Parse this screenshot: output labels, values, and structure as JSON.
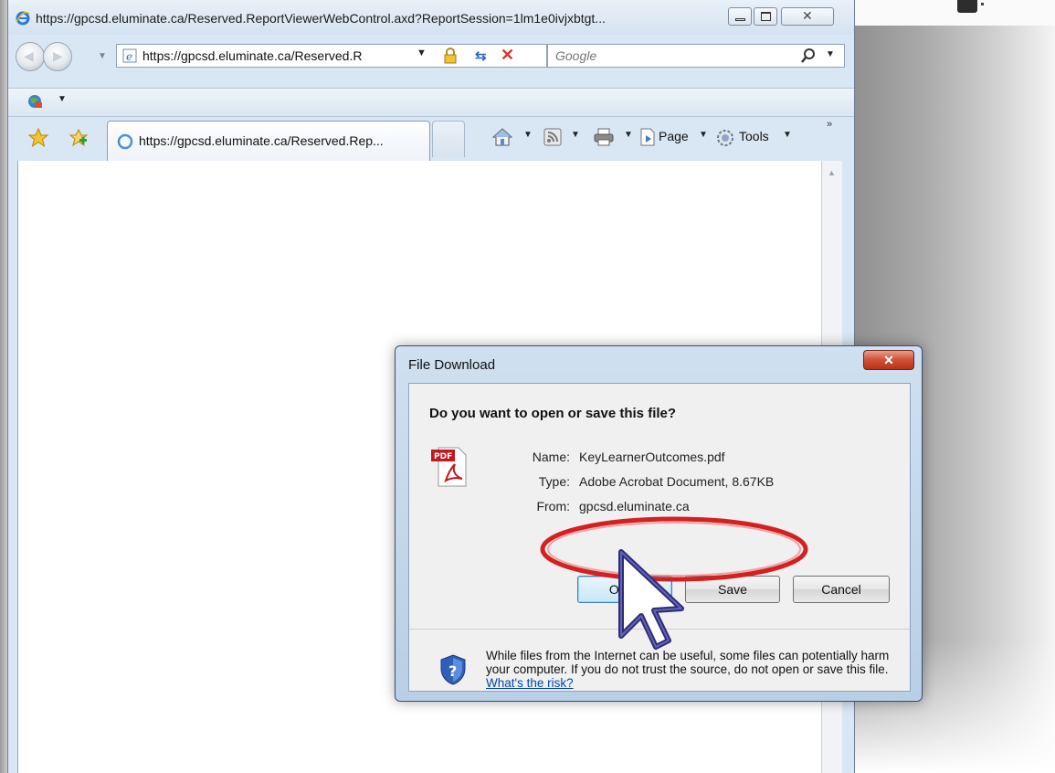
{
  "window": {
    "title": "https://gpcsd.eluminate.ca/Reserved.ReportViewerWebControl.axd?ReportSession=1lm1e0ivjxbtgt..."
  },
  "nav": {
    "address": "https://gpcsd.eluminate.ca/Reserved.R",
    "search_placeholder": "Google"
  },
  "tabs": {
    "active_label": "https://gpcsd.eluminate.ca/Reserved.Rep..."
  },
  "commands": {
    "page_label": "Page",
    "tools_label": "Tools"
  },
  "dialog": {
    "title": "File Download",
    "question": "Do you want to open or save this file?",
    "name_label": "Name:",
    "name_value": "KeyLearnerOutcomes.pdf",
    "type_label": "Type:",
    "type_value": "Adobe Acrobat Document, 8.67KB",
    "from_label": "From:",
    "from_value": "gpcsd.eluminate.ca",
    "pdf_icon_text": "PDF",
    "open_button": "Open",
    "save_button": "Save",
    "cancel_button": "Cancel",
    "warning_text": "While files from the Internet can be useful, some files can potentially harm your computer. If you do not trust the source, do not open or save this file.",
    "risk_link": "What's the risk?"
  },
  "colors": {
    "ie_frame": "#d9e6f3",
    "close_button": "#c8442a",
    "annotation_ellipse": "#d42020",
    "cursor_fill": "#3a3a8c"
  },
  "icons": [
    "ie-page-icon",
    "back-icon",
    "forward-icon",
    "lock-icon",
    "refresh-icon",
    "stop-icon",
    "search-icon",
    "globe-icon",
    "favorites-star-icon",
    "add-favorites-icon",
    "loading-icon",
    "home-icon",
    "feeds-icon",
    "print-icon",
    "page-icon",
    "tools-gear-icon",
    "pdf-icon",
    "shield-icon",
    "cursor-arrow"
  ]
}
